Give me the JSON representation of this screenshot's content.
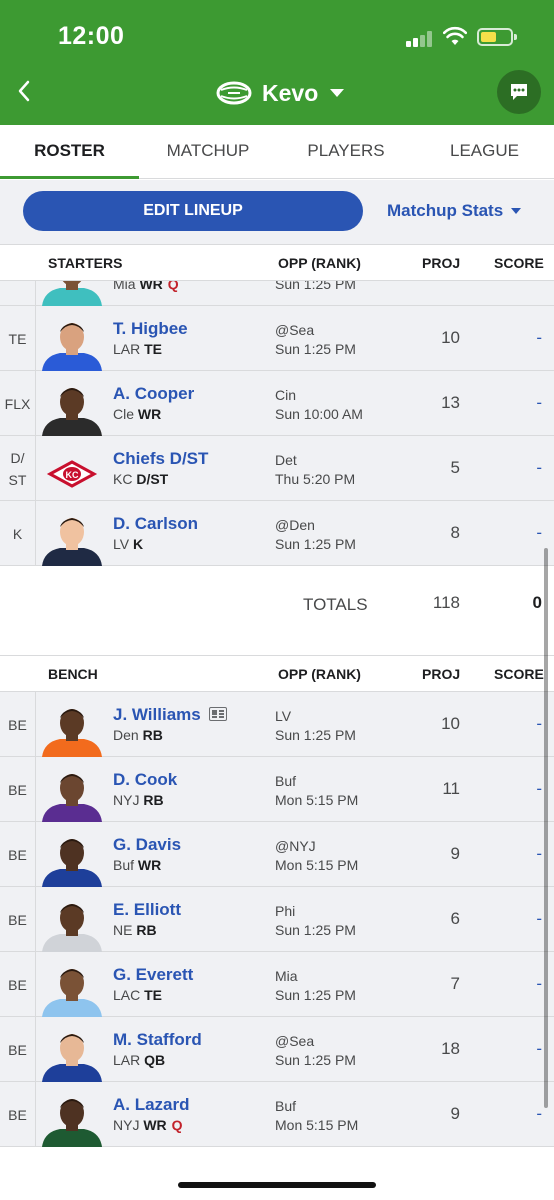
{
  "status_bar": {
    "time": "12:00"
  },
  "header": {
    "team_name": "Kevo",
    "icons": [
      "back-chevron-icon",
      "football-icon",
      "chat-icon"
    ]
  },
  "tabs": [
    {
      "label": "ROSTER",
      "active": true
    },
    {
      "label": "MATCHUP",
      "active": false
    },
    {
      "label": "PLAYERS",
      "active": false
    },
    {
      "label": "LEAGUE",
      "active": false
    }
  ],
  "actions": {
    "edit_lineup": "EDIT LINEUP",
    "matchup_stats": "Matchup Stats"
  },
  "columns": {
    "starters": "STARTERS",
    "bench": "BENCH",
    "opp": "OPP (RANK)",
    "proj": "PROJ",
    "score": "SCORE"
  },
  "starters": [
    {
      "slot": "",
      "name": "",
      "team": "Mia",
      "pos": "WR",
      "status": "Q",
      "opp": "",
      "time": "Sun 1:25 PM",
      "proj": "",
      "score": "-"
    },
    {
      "slot": "TE",
      "name": "T. Higbee",
      "team": "LAR",
      "pos": "TE",
      "status": "",
      "opp": "@Sea",
      "time": "Sun 1:25 PM",
      "proj": "10",
      "score": "-"
    },
    {
      "slot": "FLX",
      "name": "A. Cooper",
      "team": "Cle",
      "pos": "WR",
      "status": "",
      "opp": "Cin",
      "time": "Sun 10:00 AM",
      "proj": "13",
      "score": "-"
    },
    {
      "slot": "D/\nST",
      "name": "Chiefs D/ST",
      "team": "KC",
      "pos": "D/ST",
      "status": "",
      "opp": "Det",
      "time": "Thu 5:20 PM",
      "proj": "5",
      "score": "-"
    },
    {
      "slot": "K",
      "name": "D. Carlson",
      "team": "LV",
      "pos": "K",
      "status": "",
      "opp": "@Den",
      "time": "Sun 1:25 PM",
      "proj": "8",
      "score": "-"
    }
  ],
  "totals": {
    "label": "TOTALS",
    "proj": "118",
    "score": "0"
  },
  "bench": [
    {
      "slot": "BE",
      "name": "J. Williams",
      "team": "Den",
      "pos": "RB",
      "status": "",
      "opp": "LV",
      "time": "Sun 1:25 PM",
      "proj": "10",
      "score": "-",
      "news": true
    },
    {
      "slot": "BE",
      "name": "D. Cook",
      "team": "NYJ",
      "pos": "RB",
      "status": "",
      "opp": "Buf",
      "time": "Mon 5:15 PM",
      "proj": "11",
      "score": "-"
    },
    {
      "slot": "BE",
      "name": "G. Davis",
      "team": "Buf",
      "pos": "WR",
      "status": "",
      "opp": "@NYJ",
      "time": "Mon 5:15 PM",
      "proj": "9",
      "score": "-"
    },
    {
      "slot": "BE",
      "name": "E. Elliott",
      "team": "NE",
      "pos": "RB",
      "status": "",
      "opp": "Phi",
      "time": "Sun 1:25 PM",
      "proj": "6",
      "score": "-"
    },
    {
      "slot": "BE",
      "name": "G. Everett",
      "team": "LAC",
      "pos": "TE",
      "status": "",
      "opp": "Mia",
      "time": "Sun 1:25 PM",
      "proj": "7",
      "score": "-"
    },
    {
      "slot": "BE",
      "name": "M. Stafford",
      "team": "LAR",
      "pos": "QB",
      "status": "",
      "opp": "@Sea",
      "time": "Sun 1:25 PM",
      "proj": "18",
      "score": "-"
    },
    {
      "slot": "BE",
      "name": "A. Lazard",
      "team": "NYJ",
      "pos": "WR",
      "status": "Q",
      "opp": "Buf",
      "time": "Mon 5:15 PM",
      "proj": "9",
      "score": "-"
    }
  ],
  "colors": {
    "header_green": "#3d9a32",
    "link_blue": "#2a55b3",
    "row_bg": "#f0f1f4",
    "questionable_red": "#c2222b"
  }
}
